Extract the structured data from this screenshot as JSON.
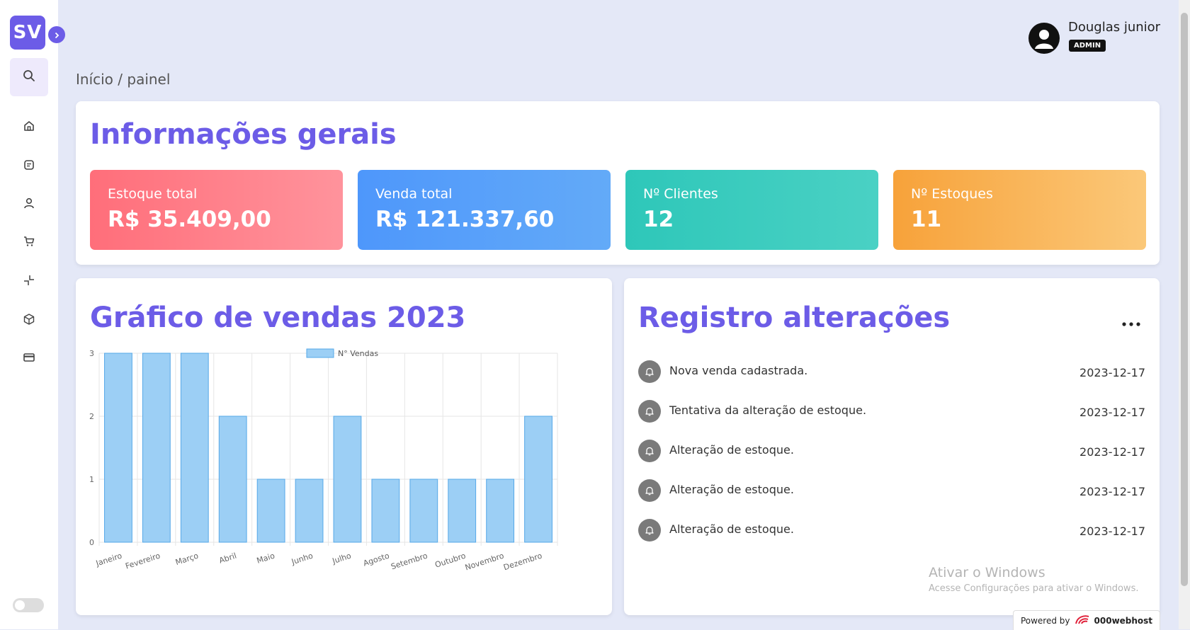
{
  "app": {
    "logo": "SV"
  },
  "user": {
    "name": "Douglas junior",
    "role": "ADMIN"
  },
  "breadcrumb": "Início / painel",
  "sidebar": {
    "icons": [
      "search-icon",
      "home-icon",
      "notes-icon",
      "user-icon",
      "cart-icon",
      "collapse-icon",
      "package-icon",
      "credit-card-icon"
    ]
  },
  "info": {
    "title": "Informações gerais",
    "stats": [
      {
        "label": "Estoque total",
        "value": "R$ 35.409,00",
        "color": "#ff6e7a"
      },
      {
        "label": "Venda total",
        "value": "R$ 121.337,60",
        "color": "#4e97fb"
      },
      {
        "label": "Nº Clientes",
        "value": "12",
        "color": "#2ec7b9"
      },
      {
        "label": "Nº Estoques",
        "value": "11",
        "color": "#f7a23a"
      }
    ]
  },
  "chart": {
    "title": "Gráfico de vendas 2023"
  },
  "chart_data": {
    "type": "bar",
    "categories": [
      "Janeiro",
      "Fevereiro",
      "Março",
      "Abril",
      "Maio",
      "Junho",
      "Julho",
      "Agosto",
      "Setembro",
      "Outubro",
      "Novembro",
      "Dezembro"
    ],
    "series": [
      {
        "name": "N° Vendas",
        "values": [
          3,
          3,
          3,
          2,
          1,
          1,
          2,
          1,
          1,
          1,
          1,
          2
        ]
      }
    ],
    "ylim": [
      0,
      3
    ],
    "yticks": [
      0,
      1,
      2,
      3
    ],
    "legend": "top",
    "grid": true,
    "bar_color": "#9ccff5",
    "bar_border": "#56a8e8"
  },
  "log": {
    "title": "Registro alterações",
    "more": "...",
    "items": [
      {
        "text": "Nova venda cadastrada.",
        "date": "2023-12-17"
      },
      {
        "text": "Tentativa da alteração de estoque.",
        "date": "2023-12-17"
      },
      {
        "text": "Alteração de estoque.",
        "date": "2023-12-17"
      },
      {
        "text": "Alteração de estoque.",
        "date": "2023-12-17"
      },
      {
        "text": "Alteração de estoque.",
        "date": "2023-12-17"
      }
    ]
  },
  "watermark": {
    "title": "Ativar o Windows",
    "subtitle": "Acesse Configurações para ativar o Windows."
  },
  "footer": {
    "powered_label": "Powered by",
    "powered_brand": "000webhost"
  }
}
